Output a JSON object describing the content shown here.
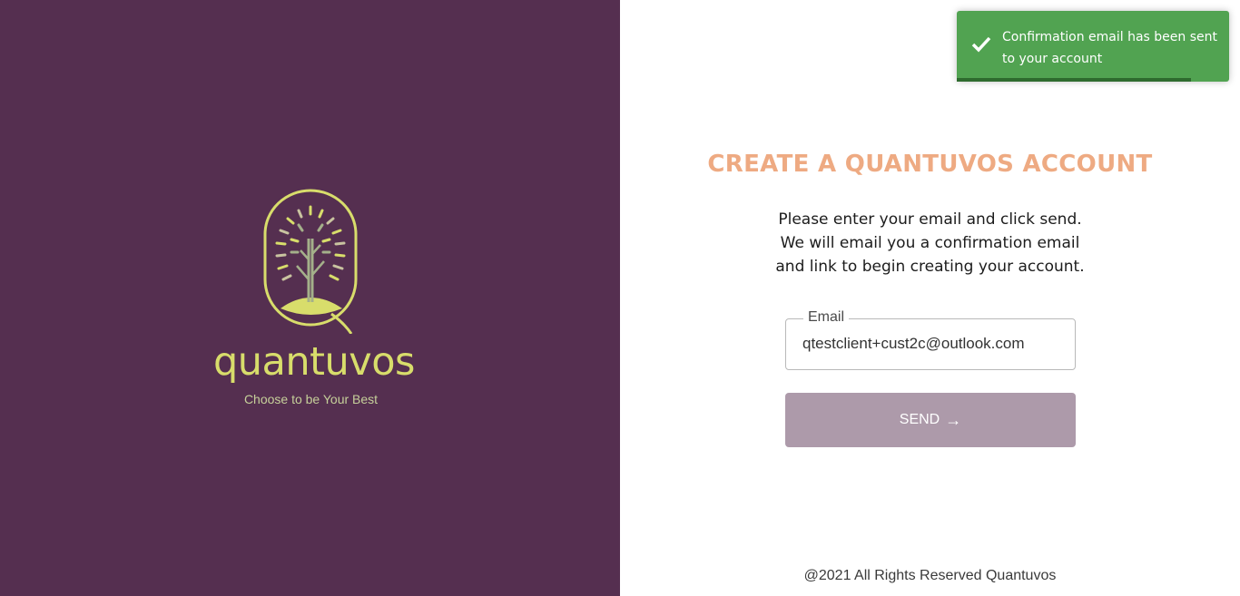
{
  "brand": {
    "name": "quantuvos",
    "tagline": "Choose to be Your Best",
    "panel_color": "#552f50",
    "logo_color": "#d8dd6b"
  },
  "form": {
    "title": "CREATE A QUANTUVOS ACCOUNT",
    "instructions": "Please enter your email and click send. We will email you a confirmation email and link to begin creating your account.",
    "email_label": "Email",
    "email_value": "qtestclient+cust2c@outlook.com",
    "send_label": "SEND",
    "send_icon": "arrow-right-icon",
    "accent_color": "#eeaa82",
    "button_color": "#ad9aaa"
  },
  "footer": {
    "text": "@2021 All Rights Reserved Quantuvos"
  },
  "toast": {
    "message": "Confirmation email has been sent to your account",
    "icon": "check-icon",
    "color": "#51a351",
    "progress": 0.86
  }
}
